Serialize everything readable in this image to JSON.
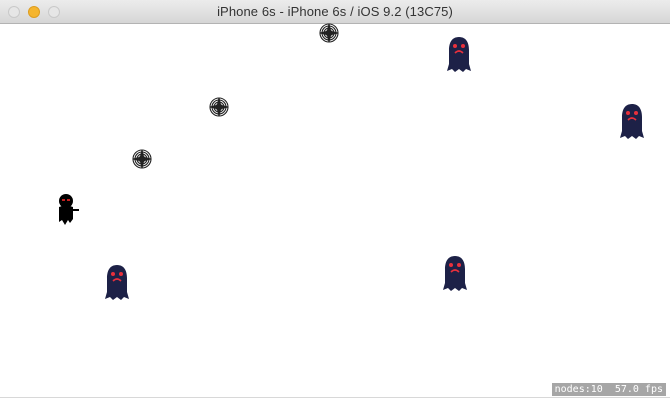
{
  "window": {
    "title": "iPhone 6s - iPhone 6s / iOS 9.2 (13C75)"
  },
  "icons": {
    "close": "close-button-icon",
    "minimize": "minimize-button-icon",
    "zoom": "zoom-button-icon",
    "player": "ninja-player-icon",
    "projectile": "shuriken-icon",
    "monster": "ghost-monster-icon"
  },
  "colors": {
    "minimize_button": "#f5b52e",
    "monster_body": "#1d2147",
    "monster_eyes": "#e8303c",
    "player_body": "#000000",
    "stats_background": "#a6a6a6"
  },
  "stats": {
    "nodes_label": "nodes:10",
    "fps_label": "57.0 fps"
  }
}
